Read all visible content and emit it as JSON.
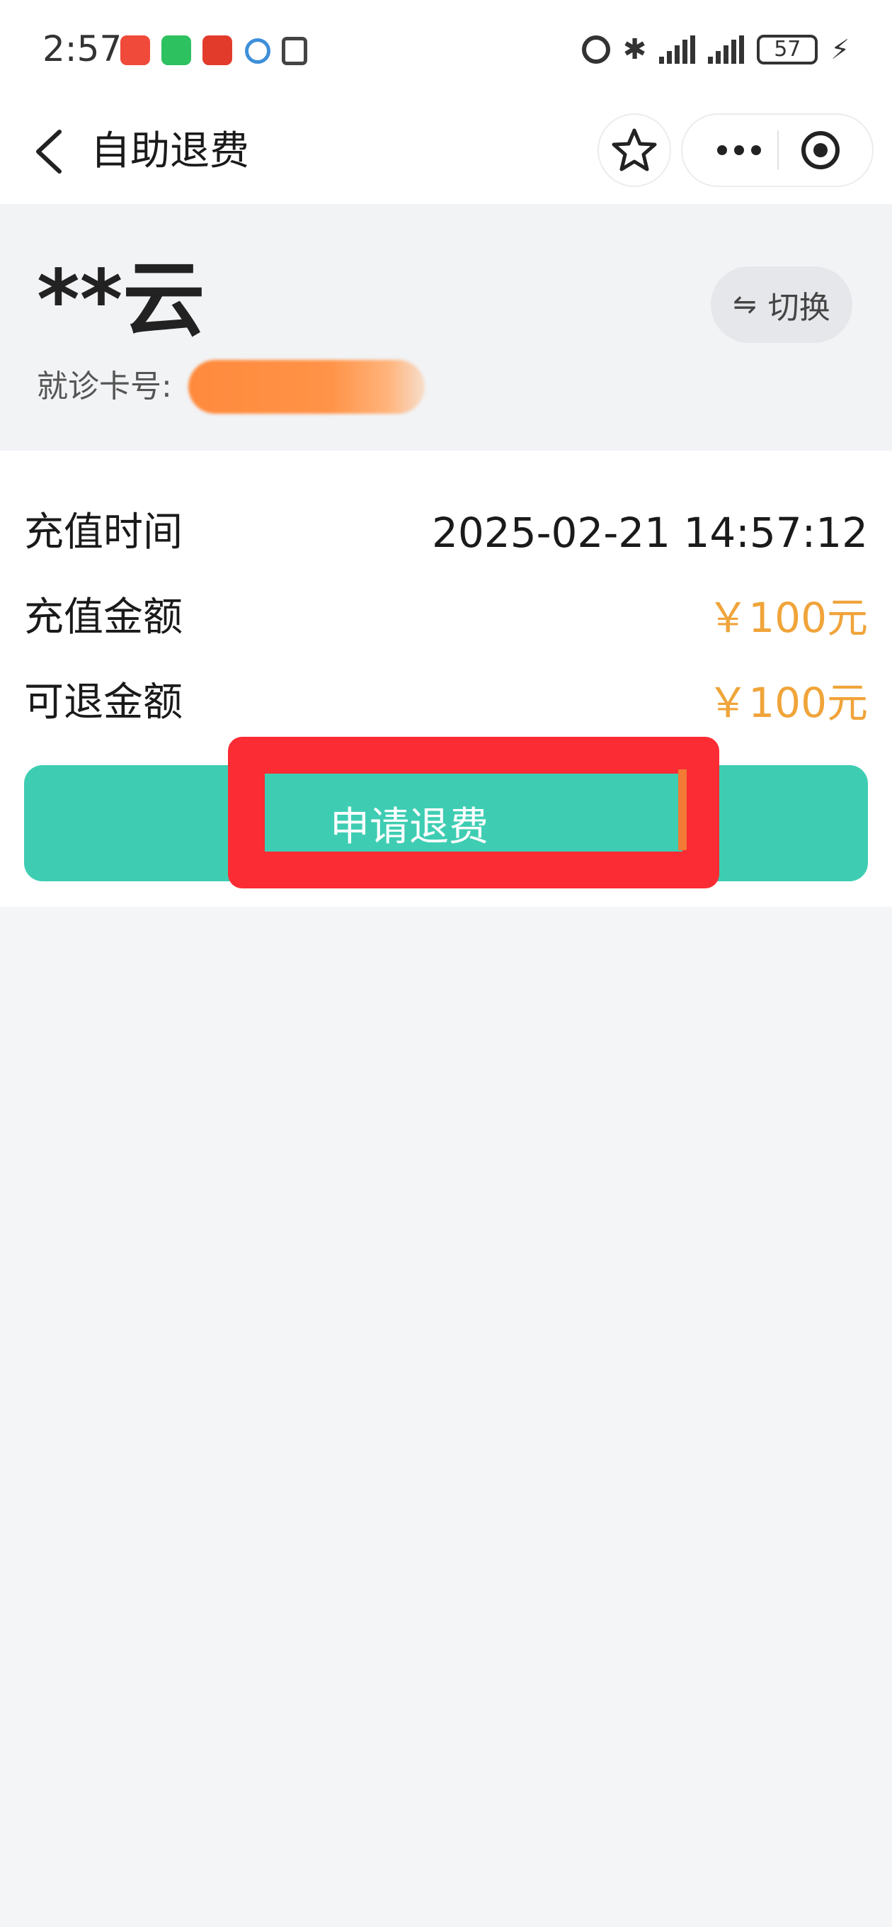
{
  "status_bar": {
    "time": "2:57",
    "battery": "57"
  },
  "nav": {
    "title": "自助退费"
  },
  "patient": {
    "name": "**云",
    "card_label": "就诊卡号:",
    "switch_label": "切换"
  },
  "details": {
    "rows": [
      {
        "label": "充值时间",
        "value": "2025-02-21 14:57:12"
      },
      {
        "label": "充值金额",
        "value": "￥100元"
      },
      {
        "label": "可退金额",
        "value": "￥100元"
      }
    ],
    "refund_button_label": "申请退费"
  },
  "colors": {
    "accent": "#3ecdb3",
    "money": "#f0a43a",
    "highlight": "#fb2c34"
  }
}
